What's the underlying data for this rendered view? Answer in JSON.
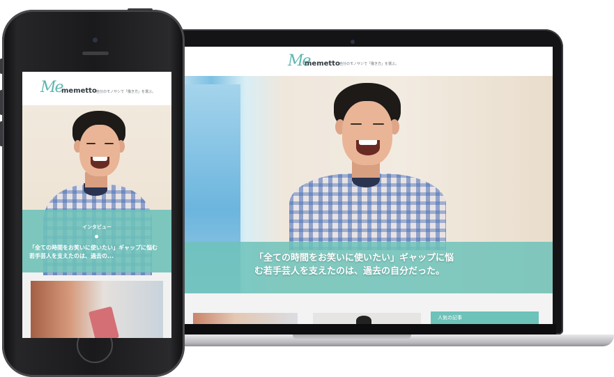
{
  "laptop": {
    "site": {
      "logo_script": "Me",
      "logo_word": "memetto",
      "tagline": "自分のモノサシで「働き方」を選ぶ。"
    },
    "hero_headline_line1": "「全ての時間をお笑いに使いたい」ギャップに悩",
    "hero_headline_line2": "む若手芸人を支えたのは、過去の自分だった。",
    "sidebar_label": "人気の記事"
  },
  "phone": {
    "site": {
      "logo_script": "Me",
      "logo_word": "memetto",
      "tagline": "自分のモノサシで「働き方」を選ぶ。"
    },
    "category": "インタビュー",
    "headline_line1": "「全ての時間をお笑いに使いたい」ギャップに悩む",
    "headline_line2": "若手芸人を支えたのは、過去の..."
  },
  "colors": {
    "accent": "#6dc2ba",
    "logo": "#5fb6b0",
    "device_frame": "#141416"
  },
  "icons": [
    "camera-icon",
    "speaker-grille",
    "home-button"
  ]
}
